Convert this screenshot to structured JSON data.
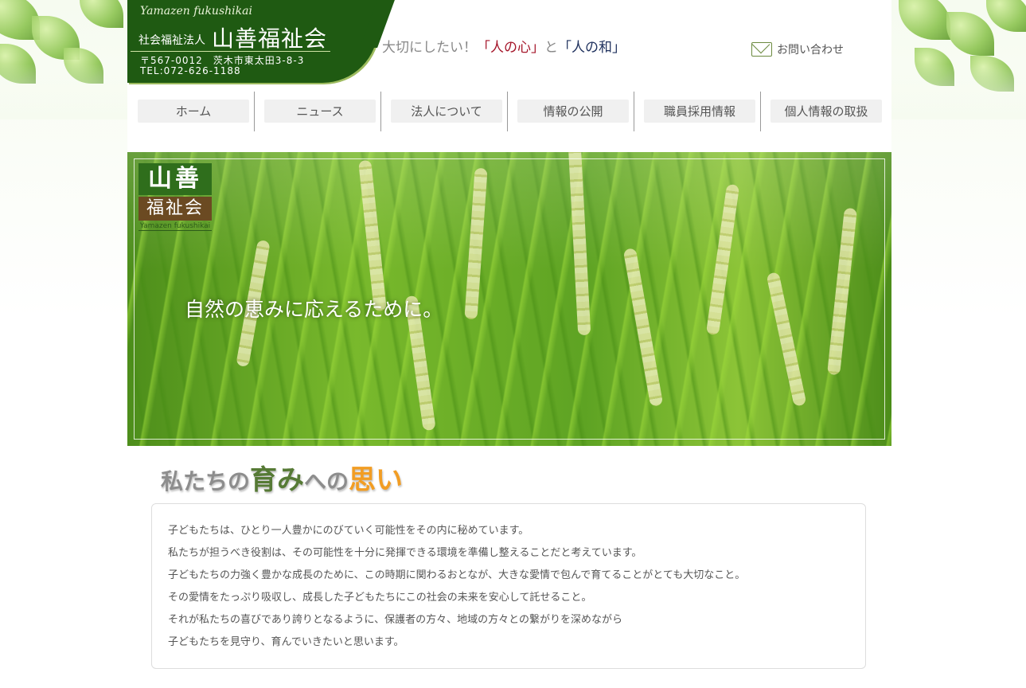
{
  "header": {
    "logo_roman": "Yamazen fukushikai",
    "logo_corp": "社会福祉法人",
    "logo_name": "山善福祉会",
    "logo_address": "〒567-0012　茨木市東太田3-8-3",
    "logo_tel": "TEL:072-626-1188",
    "tagline": {
      "prefix": "大切にしたい！",
      "part1": "「人の心」",
      "mid": "と",
      "part2": "「人の和」"
    },
    "contact_label": "お問い合わせ"
  },
  "nav": {
    "items": [
      {
        "label": "ホーム"
      },
      {
        "label": "ニュース"
      },
      {
        "label": "法人について"
      },
      {
        "label": "情報の公開"
      },
      {
        "label": "職員採用情報"
      },
      {
        "label": "個人情報の取扱"
      }
    ]
  },
  "hero": {
    "logo_top": "山善",
    "logo_bottom": "福祉会",
    "logo_sub": "Yamazen fukushikai",
    "headline": "自然の恵みに応えるために。"
  },
  "section": {
    "title_a": "私たちの",
    "title_b": "育み",
    "title_c": "への",
    "title_d": "思い",
    "paragraphs": [
      "子どもたちは、ひとり一人豊かにのびていく可能性をその内に秘めています。",
      "私たちが担うべき役割は、その可能性を十分に発揮できる環境を準備し整えることだと考えています。",
      "子どもたちの力強く豊かな成長のために、この時期に関わるおとなが、大きな愛情で包んで育てることがとても大切なこと。",
      "その愛情をたっぷり吸収し、成長した子どもたちにこの社会の未来を安心して託せること。",
      "それが私たちの喜びであり誇りとなるように、保護者の方々、地域の方々との繋がりを深めながら",
      "子どもたちを見守り、育んでいきたいと思います。"
    ]
  },
  "colors": {
    "brand_green": "#1f5a12",
    "accent_red": "#a5162a",
    "accent_navy": "#20325e",
    "accent_orange": "#f29d23"
  }
}
